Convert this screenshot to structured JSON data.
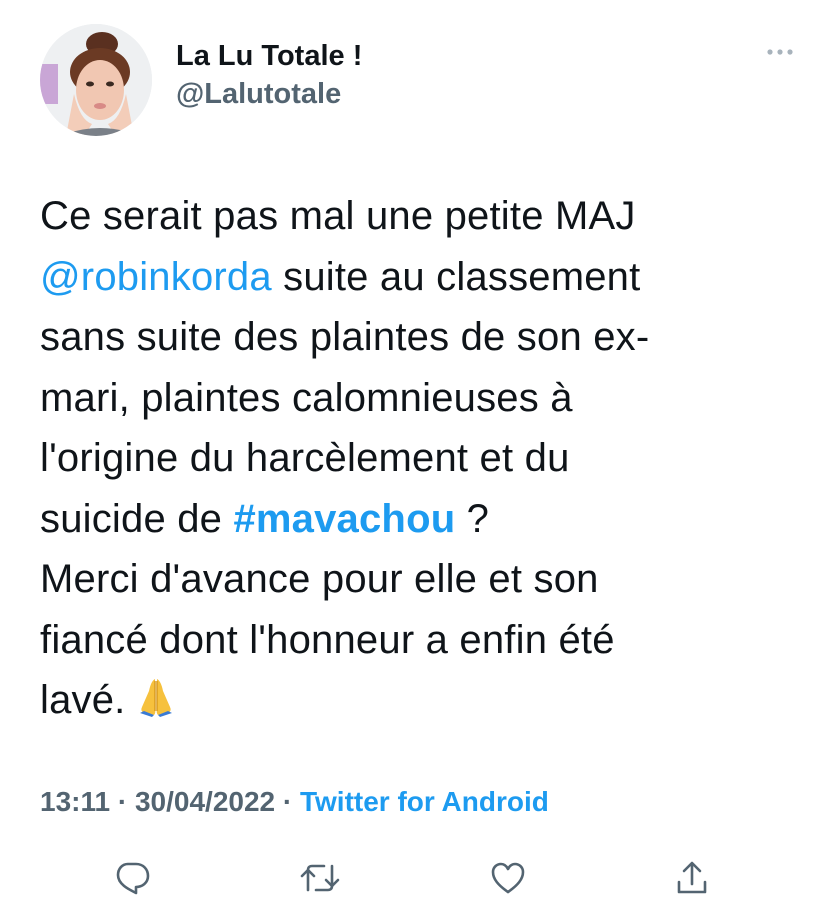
{
  "author": {
    "display_name": "La Lu Totale !",
    "handle": "@Lalutotale",
    "avatar_icon": "profile-photo"
  },
  "more_icon": "more-horizontal-icon",
  "tweet": {
    "line1": "Ce serait pas mal une petite MAJ",
    "mention": "@robinkorda",
    "line2_rest": " suite au classement",
    "line3": "sans suite des plaintes de son ex-",
    "line4": "mari, plaintes calomnieuses à",
    "line5": "l'origine du harcèlement et du",
    "line6_start": "suicide de ",
    "hashtag": "#mavachou",
    "line6_end": " ?",
    "line7": "Merci d'avance pour elle et son",
    "line8": "fiancé dont l'honneur a enfin été",
    "line9": "lavé.",
    "emoji": "praying-hands-emoji"
  },
  "meta": {
    "time": "13:11",
    "separator1": " · ",
    "date": "30/04/2022",
    "separator2": " · ",
    "source": "Twitter for Android"
  },
  "actions": {
    "reply_icon": "reply-icon",
    "retweet_icon": "retweet-icon",
    "like_icon": "heart-icon",
    "share_icon": "share-icon"
  },
  "colors": {
    "text": "#0f1419",
    "secondary": "#536471",
    "accent": "#1d9bf0",
    "background": "#ffffff"
  }
}
